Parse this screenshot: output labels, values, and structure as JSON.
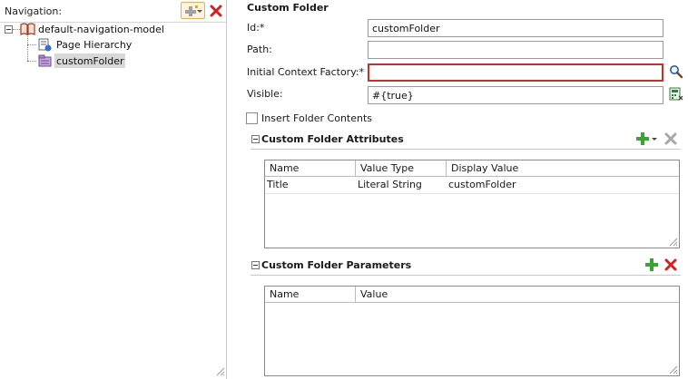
{
  "navigation": {
    "title": "Navigation:",
    "add_icon": "add-with-dropdown-icon",
    "delete_icon": "delete-icon",
    "tree": {
      "root": {
        "label": "default-navigation-model",
        "icon": "book-icon"
      },
      "children": [
        {
          "label": "Page Hierarchy",
          "icon": "page-hierarchy-icon"
        },
        {
          "label": "customFolder",
          "icon": "folder-icon",
          "selected": true
        }
      ]
    }
  },
  "details": {
    "title": "Custom Folder",
    "fields": {
      "id": {
        "label": "Id:*",
        "value": "customFolder"
      },
      "path": {
        "label": "Path:",
        "value": ""
      },
      "initial_context_factory": {
        "label": "Initial Context Factory:*",
        "value": ""
      },
      "visible": {
        "label": "Visible:",
        "value": "#{true}"
      }
    },
    "insert_folder_contents": {
      "label": "Insert Folder Contents",
      "checked": false
    }
  },
  "attributes_section": {
    "title": "Custom Folder Attributes",
    "columns": [
      "Name",
      "Value Type",
      "Display Value"
    ],
    "rows": [
      {
        "name": "Title",
        "value_type": "Literal String",
        "display_value": "customFolder"
      }
    ]
  },
  "parameters_section": {
    "title": "Custom Folder Parameters",
    "columns": [
      "Name",
      "Value"
    ],
    "rows": []
  },
  "colors": {
    "error_border": "#c23131",
    "add_green": "#3aa335",
    "delete_red": "#d42020",
    "selected_bg": "#d8d8d8"
  }
}
